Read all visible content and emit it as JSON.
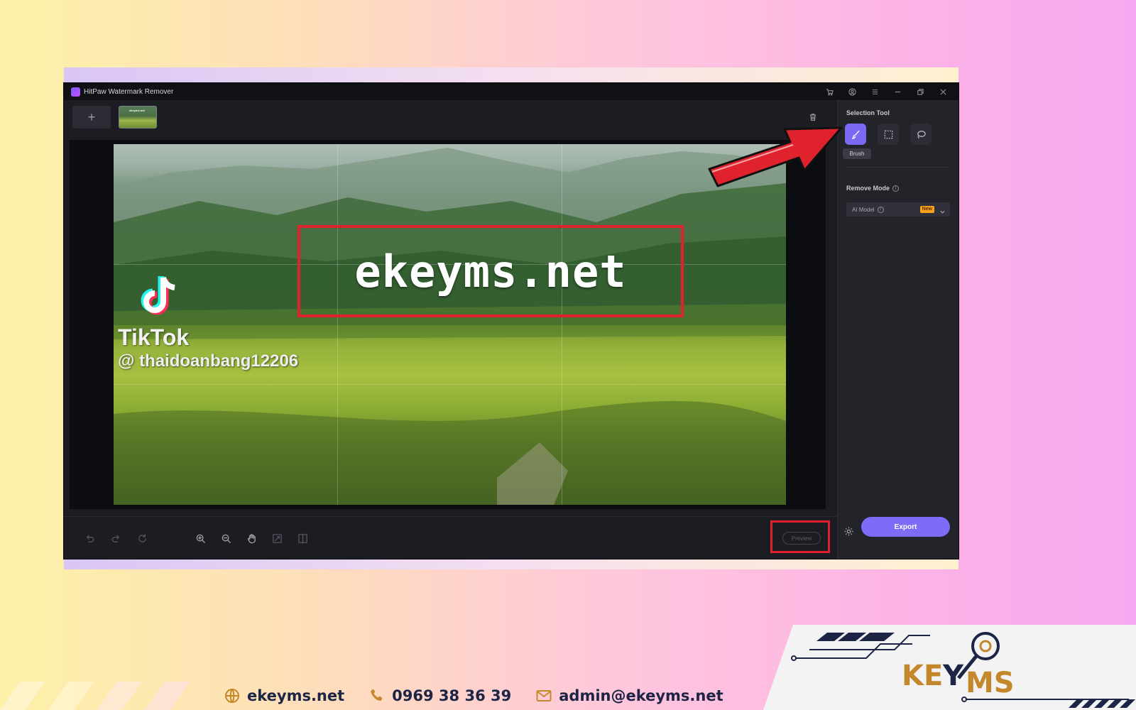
{
  "window": {
    "title": "HitPaw Watermark Remover",
    "controls": [
      "cart-icon",
      "account-icon",
      "menu-icon",
      "minimize-icon",
      "restore-icon",
      "close-icon"
    ]
  },
  "media_strip": {
    "add_label": "+",
    "thumbnail_text": "ekeyms.net"
  },
  "video": {
    "watermark_text": "ekeyms.net",
    "tiktok_name": "TikTok",
    "tiktok_handle": "@ thaidoanbang12206"
  },
  "side_panel": {
    "selection_heading": "Selection Tool",
    "tools": [
      {
        "name": "Brush",
        "icon": "brush-icon",
        "active": true
      },
      {
        "name": "Rectangle",
        "icon": "rect-select-icon",
        "active": false
      },
      {
        "name": "Lasso",
        "icon": "lasso-icon",
        "active": false
      }
    ],
    "brush_tooltip": "Brush",
    "remove_mode_heading": "Remove Mode",
    "mode_value": "AI Model",
    "mode_badge": "New",
    "export_label": "Export"
  },
  "bottom_toolbar": {
    "icons": [
      "undo-icon",
      "redo-icon",
      "reset-icon",
      "zoom-in-icon",
      "zoom-out-icon",
      "hand-icon",
      "fit-screen-icon",
      "split-view-icon"
    ],
    "preview_label": "Preview"
  },
  "footer": {
    "website": "ekeyms.net",
    "phone": "0969 38 36 39",
    "email": "admin@ekeyms.net",
    "brand_logo_text": "KEYMS"
  },
  "colors": {
    "accent": "#7c6cf6",
    "highlight_red": "#e0222c",
    "badge_orange": "#f6a21a",
    "brand_blue": "#1c2546",
    "brand_gold": "#c4872b"
  }
}
